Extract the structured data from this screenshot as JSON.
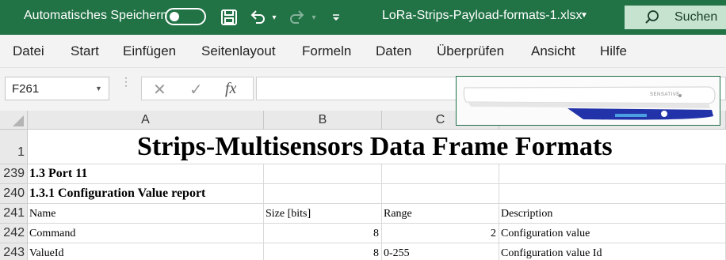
{
  "titlebar": {
    "autosave_label": "Automatisches Speichern",
    "filename": "LoRa-Strips-Payload-formats-1.xlsx",
    "search_label": "Suchen",
    "bg_color": "#217346"
  },
  "menu": {
    "items": [
      "Datei",
      "Start",
      "Einfügen",
      "Seitenlayout",
      "Formeln",
      "Daten",
      "Überprüfen",
      "Ansicht",
      "Hilfe"
    ]
  },
  "formulabar": {
    "namebox": "F261",
    "cancel_symbol": "✕",
    "enter_symbol": "✓",
    "fx_symbol": "fx",
    "value": ""
  },
  "sheet": {
    "columns": [
      "A",
      "B",
      "C"
    ],
    "title_row": {
      "row": "1",
      "text": "Strips-Multisensors Data Frame Formats"
    },
    "rows": [
      {
        "row": "239",
        "cells": [
          "1.3 Port 11",
          "",
          "",
          ""
        ]
      },
      {
        "row": "240",
        "cells": [
          "1.3.1 Configuration Value report",
          "",
          "",
          ""
        ]
      },
      {
        "row": "241",
        "cells": [
          "Name",
          "Size [bits]",
          "Range",
          "Description"
        ]
      },
      {
        "row": "242",
        "cells": [
          "Command",
          "8",
          "2",
          "Configuration value"
        ]
      },
      {
        "row": "243",
        "cells": [
          "ValueId",
          "8",
          "0-255",
          "Configuration value Id"
        ]
      }
    ]
  },
  "picture": {
    "brand_text": "SENSATIVE",
    "device_color": "#2233aa"
  }
}
